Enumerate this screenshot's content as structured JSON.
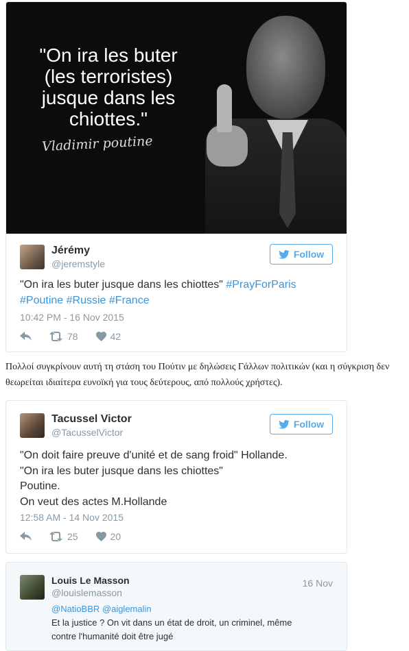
{
  "tweet1": {
    "image": {
      "quote_lines": [
        "\"On ira les buter",
        "(les terroristes)",
        "jusque dans les",
        "chiottes.\""
      ],
      "signature": "Vladimir poutine"
    },
    "author_name": "Jérémy",
    "author_handle": "@jeremstyle",
    "follow_label": "Follow",
    "text_plain": "\"On ira les buter jusque dans les chiottes\" ",
    "hashtags": [
      "#PrayForParis",
      "#Poutine",
      "#Russie",
      "#France"
    ],
    "timestamp": "10:42 PM - 16 Nov 2015",
    "retweets": "78",
    "likes": "42"
  },
  "paragraph": "Πολλοί συγκρίνουν αυτή τη στάση του Πούτιν με δηλώσεις Γάλλων πολιτικών (και η σύγκριση δεν θεωρείται ιδιαίτερα ευνοϊκή για τους δεύτερους, από πολλούς χρήστες).",
  "tweet2": {
    "author_name": "Tacussel Victor",
    "author_handle": "@TacusselVictor",
    "follow_label": "Follow",
    "lines": [
      "\"On doit faire preuve d'unité et de sang froid\" Hollande.",
      "\"On ira les buter jusque dans les chiottes\"",
      "Poutine.",
      "On veut des actes M.Hollande"
    ],
    "timestamp": "12:58 AM - 14 Nov 2015",
    "retweets": "25",
    "likes": "20"
  },
  "tweet3": {
    "author_name": "Louis Le Masson",
    "author_handle": "@louislemasson",
    "date": "16 Nov",
    "mentions": "@NatioBBR @aiglemalin",
    "lines": [
      "Et la justice ? On vit dans un état de droit, un criminel, même",
      "contre l'humanité doit être jugé"
    ]
  },
  "colors": {
    "accent": "#55acee",
    "link": "#3b94d9",
    "muted": "#8899a6"
  },
  "icons": [
    "twitter-bird-icon",
    "reply-icon",
    "retweet-icon",
    "heart-icon"
  ]
}
